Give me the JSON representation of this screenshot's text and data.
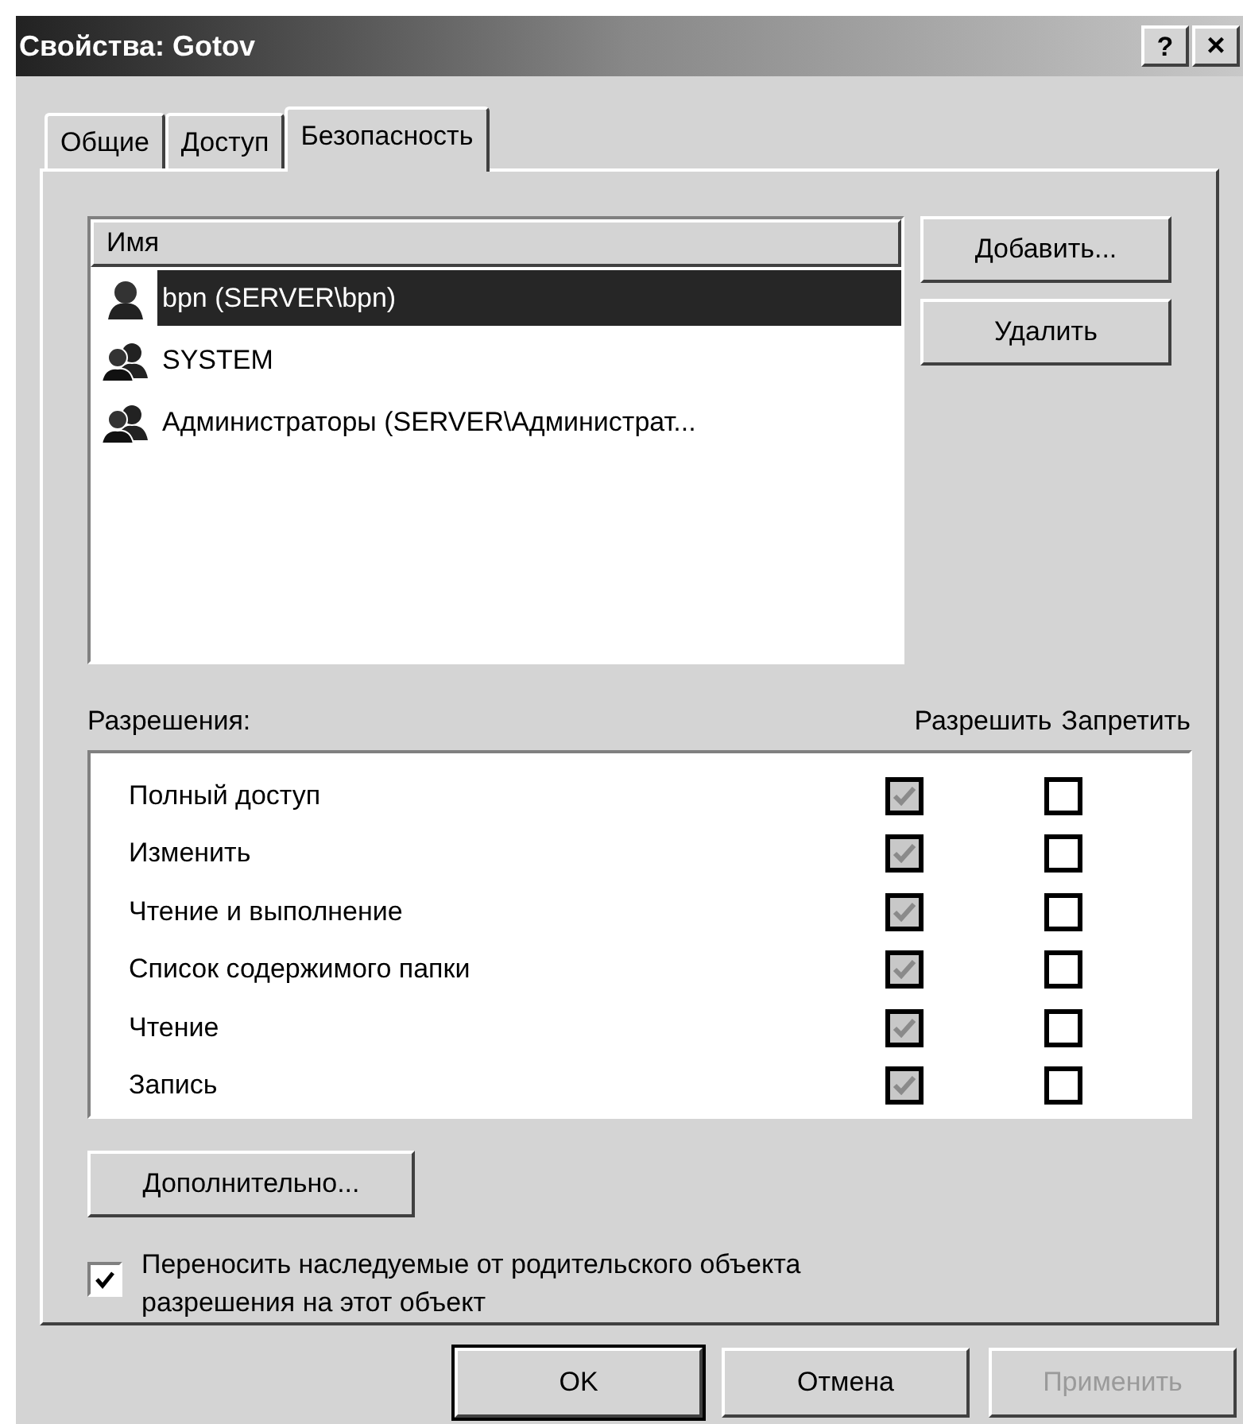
{
  "window": {
    "title": "Свойства: Gotov",
    "help": "?",
    "close": "×"
  },
  "tabs": [
    {
      "label": "Общие",
      "selected": false
    },
    {
      "label": "Доступ",
      "selected": false
    },
    {
      "label": "Безопасность",
      "selected": true
    }
  ],
  "users": {
    "column": "Имя",
    "items": [
      {
        "name": "bpn (SERVER\\bpn)",
        "kind": "user",
        "selected": true
      },
      {
        "name": "SYSTEM",
        "kind": "group",
        "selected": false
      },
      {
        "name": "Администраторы (SERVER\\Администрат...",
        "kind": "group",
        "selected": false
      }
    ]
  },
  "user_buttons": [
    {
      "label": "Добавить..."
    },
    {
      "label": "Удалить"
    }
  ],
  "permissions": {
    "label": "Разрешения:",
    "allow": "Разрешить",
    "deny": "Запретить",
    "rows": [
      {
        "name": "Полный доступ",
        "allow": {
          "checked": true,
          "disabled": true
        },
        "deny": {
          "checked": false,
          "disabled": false
        }
      },
      {
        "name": "Изменить",
        "allow": {
          "checked": true,
          "disabled": true
        },
        "deny": {
          "checked": false,
          "disabled": false
        }
      },
      {
        "name": "Чтение и выполнение",
        "allow": {
          "checked": true,
          "disabled": true
        },
        "deny": {
          "checked": false,
          "disabled": false
        }
      },
      {
        "name": "Список содержимого папки",
        "allow": {
          "checked": true,
          "disabled": true
        },
        "deny": {
          "checked": false,
          "disabled": false
        }
      },
      {
        "name": "Чтение",
        "allow": {
          "checked": true,
          "disabled": true
        },
        "deny": {
          "checked": false,
          "disabled": false
        }
      },
      {
        "name": "Запись",
        "allow": {
          "checked": true,
          "disabled": true
        },
        "deny": {
          "checked": false,
          "disabled": false
        }
      }
    ]
  },
  "advanced_button": "Дополнительно...",
  "inherit": {
    "label": "Переносить наследуемые от родительского объекта разрешения на этот объект",
    "checked": true
  },
  "footer_buttons": [
    {
      "label": "OK",
      "disabled": false,
      "default": true
    },
    {
      "label": "Отмена",
      "disabled": false,
      "default": false
    },
    {
      "label": "Применить",
      "disabled": true,
      "default": false
    }
  ]
}
